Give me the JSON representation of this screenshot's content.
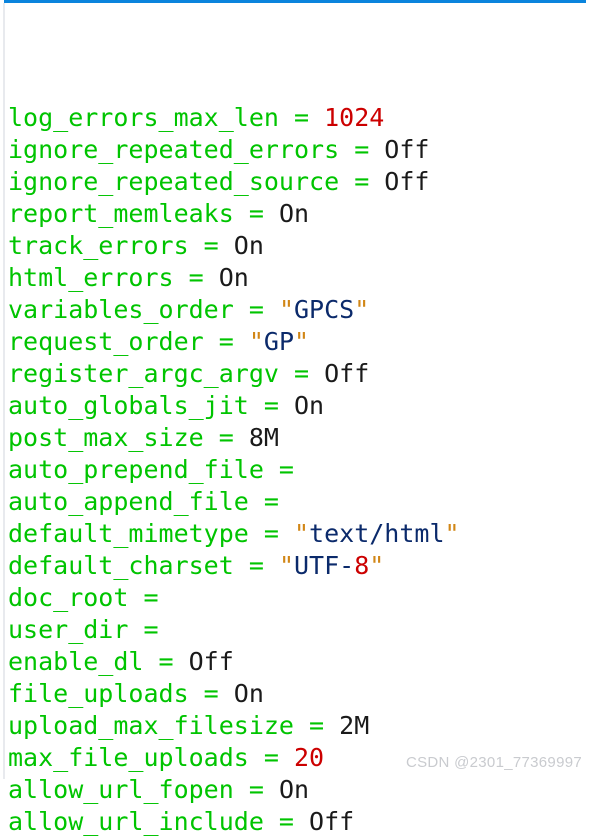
{
  "window": {
    "title": "php.ini configuration output",
    "accent_color": "#0a84dd",
    "background_color": "#ffffff",
    "gutter_color": "#e8eaee"
  },
  "colors": {
    "key": "#00c400",
    "equals": "#00c400",
    "value": "#1a1a1a",
    "number": "#cc0000",
    "quote": "#d18616",
    "string": "#0b2a6b",
    "cursor_background": "#00e000",
    "cursor_foreground": "#000000",
    "watermark": "#c9cbcf"
  },
  "cursor": {
    "line_index": 23,
    "character": "a",
    "name": "block-cursor"
  },
  "code": {
    "lines": [
      {
        "key": "log_errors_max_len",
        "eq": "=",
        "num": "1024"
      },
      {
        "key": "ignore_repeated_errors",
        "eq": "=",
        "val": "Off"
      },
      {
        "key": "ignore_repeated_source",
        "eq": "=",
        "val": "Off"
      },
      {
        "key": "report_memleaks",
        "eq": "=",
        "val": "On"
      },
      {
        "key": "track_errors",
        "eq": "=",
        "val": "On"
      },
      {
        "key": "html_errors",
        "eq": "=",
        "val": "On"
      },
      {
        "key": "variables_order",
        "eq": "=",
        "q1": "\"",
        "str": "GPCS",
        "q2": "\""
      },
      {
        "key": "request_order",
        "eq": "=",
        "q1": "\"",
        "str": "GP",
        "q2": "\""
      },
      {
        "key": "register_argc_argv",
        "eq": "=",
        "val": "Off"
      },
      {
        "key": "auto_globals_jit",
        "eq": "=",
        "val": "On"
      },
      {
        "key": "post_max_size",
        "eq": "=",
        "val": "8M"
      },
      {
        "key": "auto_prepend_file",
        "eq": "=",
        "val": ""
      },
      {
        "key": "auto_append_file",
        "eq": "=",
        "val": ""
      },
      {
        "key": "default_mimetype",
        "eq": "=",
        "q1": "\"",
        "str": "text/html",
        "q2": "\""
      },
      {
        "key": "default_charset",
        "eq": "=",
        "q1": "\"",
        "str": "UTF-",
        "num": "8",
        "q2": "\""
      },
      {
        "key": "doc_root",
        "eq": "=",
        "val": ""
      },
      {
        "key": "user_dir",
        "eq": "=",
        "val": ""
      },
      {
        "key": "enable_dl",
        "eq": "=",
        "val": "Off"
      },
      {
        "key": "file_uploads",
        "eq": "=",
        "val": "On"
      },
      {
        "key": "upload_max_filesize",
        "eq": "=",
        "val": "2M"
      },
      {
        "key": "max_file_uploads",
        "eq": "=",
        "num": "20"
      },
      {
        "key": "allow_url_fopen",
        "eq": "=",
        "val": "On"
      },
      {
        "key": "allow_url_include",
        "eq": "=",
        "val": "Off",
        "cursor_head": "a",
        "key_tail": "llow_url_include"
      }
    ]
  },
  "watermark": {
    "text": "CSDN @2301_77369997"
  }
}
